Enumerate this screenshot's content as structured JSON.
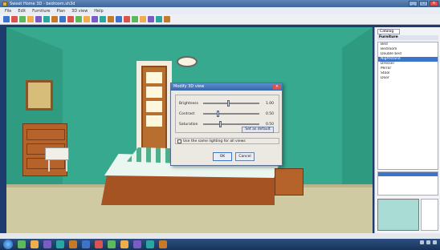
{
  "window": {
    "title": "Sweet Home 3D - bedroom.sh3d"
  },
  "menu": [
    "File",
    "Edit",
    "Furniture",
    "Plan",
    "3D view",
    "Help"
  ],
  "toolbar_icons": [
    "new-icon",
    "open-icon",
    "save-icon",
    "cut-icon",
    "copy-icon",
    "paste-icon",
    "undo-icon",
    "redo-icon",
    "add-furniture-icon",
    "select-icon",
    "wall-icon",
    "room-icon",
    "dimension-icon",
    "text-icon",
    "zoom-in-icon",
    "zoom-out-icon",
    "import-icon",
    "export-icon",
    "photo-icon",
    "video-icon",
    "help-icon"
  ],
  "dialog": {
    "title": "Modify 3D view",
    "sliders": [
      {
        "label": "Brightness",
        "value_text": "1.00",
        "level": 0.45
      },
      {
        "label": "Contrast",
        "value_text": "0.50",
        "level": 0.25
      },
      {
        "label": "Saturation",
        "value_text": "0.50",
        "level": 0.3
      }
    ],
    "default_label": "Set as default",
    "checkbox_label": "Use the same lighting for all views",
    "ok_label": "OK",
    "cancel_label": "Cancel"
  },
  "panel": {
    "tab_label": "Catalog",
    "header": "Furniture",
    "items": [
      "Bed",
      "Bedroom",
      "Double bed",
      "Nightstand",
      "Dresser",
      "Mirror",
      "Stool",
      "Door"
    ],
    "selected_index": 3
  },
  "status": {
    "text": ""
  },
  "taskbar": {
    "icons": [
      "ie-icon",
      "folder-icon",
      "media-icon",
      "app-icon-1",
      "app-icon-2",
      "app-icon-3",
      "app-icon-4",
      "app-icon-5",
      "app-icon-6",
      "app-icon-7",
      "app-icon-8",
      "app-icon-9"
    ]
  },
  "colors": {
    "wall": "#37a98e",
    "floor": "#cfcaa2",
    "wood": "#b5622b",
    "accent": "#3b74c9"
  }
}
